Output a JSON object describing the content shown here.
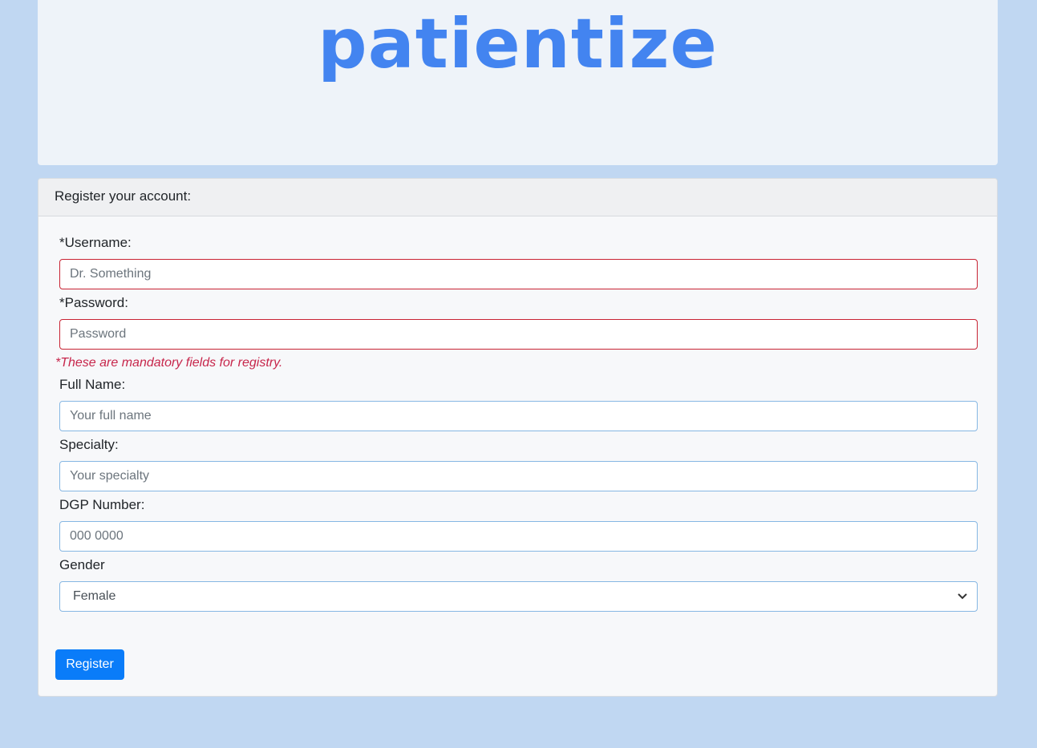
{
  "brand": {
    "logo_text": "patientize",
    "color": "#4384f0"
  },
  "card": {
    "header": "Register your account:"
  },
  "fields": [
    {
      "label": "*Username:",
      "placeholder": "Dr. Something",
      "required": true
    },
    {
      "label": "*Password:",
      "placeholder": "Password",
      "required": true
    },
    {
      "label": "Full Name:",
      "placeholder": "Your full name",
      "required": false
    },
    {
      "label": "Specialty:",
      "placeholder": "Your specialty",
      "required": false
    },
    {
      "label": "DGP Number:",
      "placeholder": "000 0000",
      "required": false
    }
  ],
  "mandatory_note": "*These are mandatory fields for registry.",
  "gender": {
    "label": "Gender",
    "selected": "Female",
    "chevron_icon": "chevron-down-icon"
  },
  "register_button": "Register",
  "colors": {
    "background": "#c0d7f2",
    "button": "#0a7cf9",
    "error": "#c7264b"
  }
}
